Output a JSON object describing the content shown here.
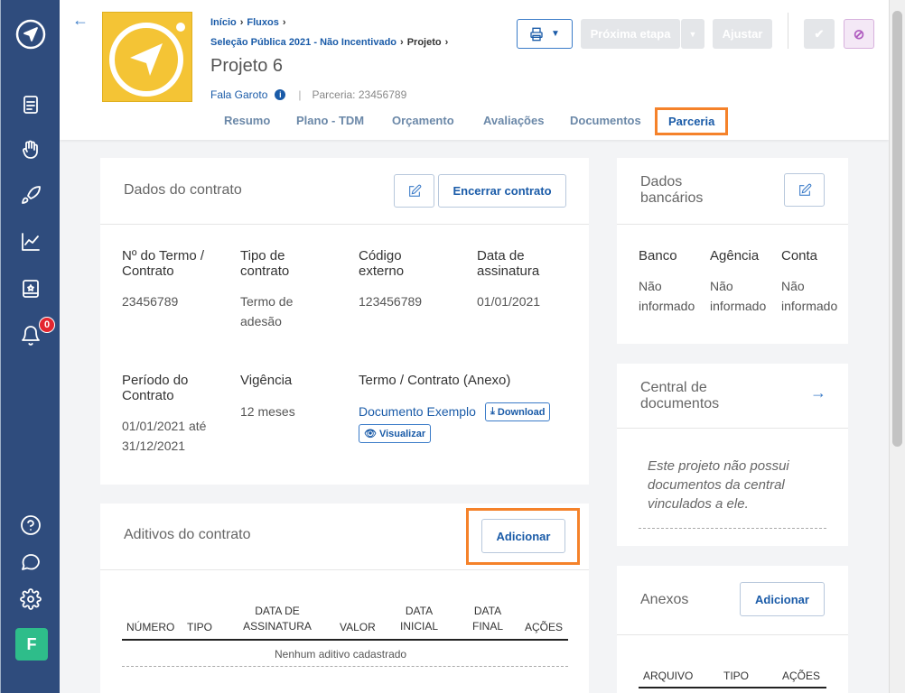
{
  "breadcrumb": {
    "items": [
      "Início",
      "Fluxos"
    ],
    "line2": [
      "Seleção Pública 2021 - Não Incentivado",
      "Projeto"
    ]
  },
  "project": {
    "title": "Projeto 6",
    "owner": "Fala Garoto",
    "partnership": "Parceria: 23456789"
  },
  "tabs": [
    "Resumo",
    "Plano - TDM",
    "Orçamento",
    "Avaliações",
    "Documentos",
    "Parceria"
  ],
  "active_tab": "Parceria",
  "header_buttons": {
    "next_step": "Próxima etapa",
    "adjust": "Ajustar"
  },
  "sidebar": {
    "notification_count": "0",
    "avatar_letter": "F"
  },
  "contract": {
    "title": "Dados do contrato",
    "close_button": "Encerrar contrato",
    "fields": {
      "term_label": "Nº do Termo / Contrato",
      "term_value": "23456789",
      "type_label": "Tipo de contrato",
      "type_value": "Termo de adesão",
      "code_label": "Código externo",
      "code_value": "123456789",
      "sign_label": "Data de assinatura",
      "sign_value": "01/01/2021",
      "period_label": "Período do Contrato",
      "period_value": "01/01/2021 até 31/12/2021",
      "validity_label": "Vigência",
      "validity_value": "12 meses",
      "attach_label": "Termo / Contrato (Anexo)",
      "attach_link": "Documento Exemplo",
      "download": "Download",
      "view": "Visualizar"
    }
  },
  "addenda": {
    "title": "Aditivos do contrato",
    "add_button": "Adicionar",
    "columns": [
      "NÚMERO",
      "TIPO",
      "DATA DE ASSINATURA",
      "VALOR",
      "DATA INICIAL",
      "DATA FINAL",
      "AÇÕES"
    ],
    "empty": "Nenhum aditivo cadastrado"
  },
  "bank": {
    "title": "Dados bancários",
    "columns": [
      "Banco",
      "Agência",
      "Conta"
    ],
    "values": [
      "Não informado",
      "Não informado",
      "Não informado"
    ]
  },
  "doc_center": {
    "title": "Central de documentos",
    "note": "Este projeto não possui documentos da central vinculados a ele."
  },
  "annexes": {
    "title": "Anexos",
    "add_button": "Adicionar",
    "columns": [
      "ARQUIVO",
      "TIPO",
      "AÇÕES"
    ]
  },
  "colors": {
    "sidebar": "#2f4c7d",
    "accent": "#1a5ba8",
    "highlight": "#f5822a",
    "logo": "#f4c435"
  }
}
